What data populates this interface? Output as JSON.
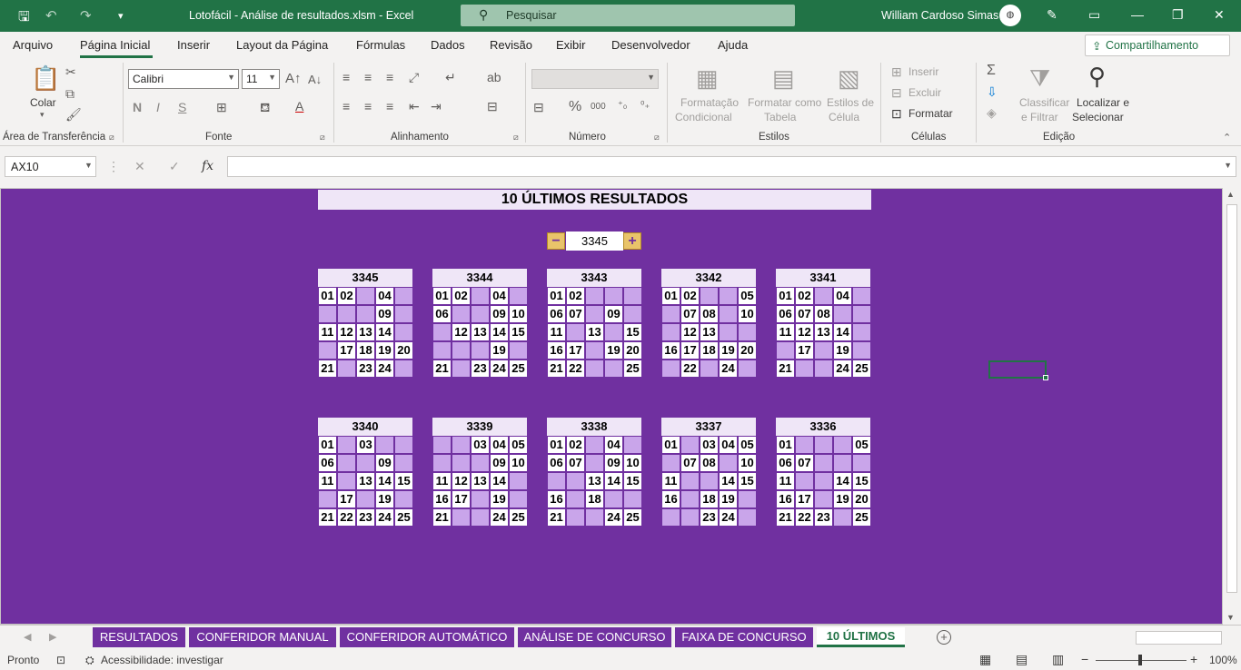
{
  "titlebar": {
    "title": "Lotofácil - Análise de resultados.xlsm  -  Excel",
    "search_placeholder": "Pesquisar",
    "user": "William Cardoso Simas"
  },
  "ribbon_tabs": [
    "Arquivo",
    "Página Inicial",
    "Inserir",
    "Layout da Página",
    "Fórmulas",
    "Dados",
    "Revisão",
    "Exibir",
    "Desenvolvedor",
    "Ajuda"
  ],
  "active_tab": "Página Inicial",
  "share_label": "Compartilhamento",
  "ribbon": {
    "clipboard": {
      "paste": "Colar",
      "group": "Área de Transferência"
    },
    "font": {
      "name": "Calibri",
      "size": "11",
      "group": "Fonte",
      "bold": "N",
      "italic": "I",
      "underline": "S"
    },
    "alignment": {
      "group": "Alinhamento"
    },
    "number": {
      "group": "Número",
      "format": "",
      "percent": "%",
      "thousands": "000"
    },
    "styles": {
      "group": "Estilos",
      "cond_format_1": "Formatação",
      "cond_format_2": "Condicional",
      "table_1": "Formatar como",
      "table_2": "Tabela",
      "cell_1": "Estilos de",
      "cell_2": "Célula"
    },
    "cells": {
      "group": "Células",
      "insert": "Inserir",
      "delete": "Excluir",
      "format": "Formatar"
    },
    "editing": {
      "group": "Edição",
      "sort_1": "Classificar",
      "sort_2": "e Filtrar",
      "find_1": "Localizar e",
      "find_2": "Selecionar"
    }
  },
  "formula_bar": {
    "name_box": "AX10",
    "fx": "fx",
    "formula": ""
  },
  "sheet": {
    "banner": "10 ÚLTIMOS RESULTADOS",
    "spinner_value": "3345",
    "spinner_minus": "−",
    "spinner_plus": "+",
    "cards": [
      {
        "id": "3345",
        "cells": [
          "01",
          "02",
          "",
          "04",
          "",
          "",
          "",
          "",
          "09",
          "",
          "11",
          "12",
          "13",
          "14",
          "",
          "",
          "17",
          "18",
          "19",
          "20",
          "21",
          "",
          "23",
          "24",
          ""
        ]
      },
      {
        "id": "3344",
        "cells": [
          "01",
          "02",
          "",
          "04",
          "",
          "06",
          "",
          "",
          "09",
          "10",
          "",
          "12",
          "13",
          "14",
          "15",
          "",
          "",
          "",
          "19",
          "",
          "21",
          "",
          "23",
          "24",
          "25"
        ]
      },
      {
        "id": "3343",
        "cells": [
          "01",
          "02",
          "",
          "",
          "",
          "06",
          "07",
          "",
          "09",
          "",
          "11",
          "",
          "13",
          "",
          "15",
          "16",
          "17",
          "",
          "19",
          "20",
          "21",
          "22",
          "",
          "",
          "25"
        ]
      },
      {
        "id": "3342",
        "cells": [
          "01",
          "02",
          "",
          "",
          "05",
          "",
          "07",
          "08",
          "",
          "10",
          "",
          "12",
          "13",
          "",
          "",
          "16",
          "17",
          "18",
          "19",
          "20",
          "",
          "22",
          "",
          "24",
          ""
        ]
      },
      {
        "id": "3341",
        "cells": [
          "01",
          "02",
          "",
          "04",
          "",
          "06",
          "07",
          "08",
          "",
          "",
          "11",
          "12",
          "13",
          "14",
          "",
          "",
          "17",
          "",
          "19",
          "",
          "21",
          "",
          "",
          "24",
          "25"
        ]
      },
      {
        "id": "3340",
        "cells": [
          "01",
          "",
          "03",
          "",
          "",
          "06",
          "",
          "",
          "09",
          "",
          "11",
          "",
          "13",
          "14",
          "15",
          "",
          "17",
          "",
          "19",
          "",
          "21",
          "22",
          "23",
          "24",
          "25"
        ]
      },
      {
        "id": "3339",
        "cells": [
          "",
          "",
          "03",
          "04",
          "05",
          "",
          "",
          "",
          "09",
          "10",
          "11",
          "12",
          "13",
          "14",
          "",
          "16",
          "17",
          "",
          "19",
          "",
          "21",
          "",
          "",
          "24",
          "25"
        ]
      },
      {
        "id": "3338",
        "cells": [
          "01",
          "02",
          "",
          "04",
          "",
          "06",
          "07",
          "",
          "09",
          "10",
          "",
          "",
          "13",
          "14",
          "15",
          "16",
          "",
          "18",
          "",
          "",
          "21",
          "",
          "",
          "24",
          "25"
        ]
      },
      {
        "id": "3337",
        "cells": [
          "01",
          "",
          "03",
          "04",
          "05",
          "",
          "07",
          "08",
          "",
          "10",
          "11",
          "",
          "",
          "14",
          "15",
          "16",
          "",
          "18",
          "19",
          "",
          "",
          "",
          "23",
          "24",
          ""
        ]
      },
      {
        "id": "3336",
        "cells": [
          "01",
          "",
          "",
          "",
          "05",
          "06",
          "07",
          "",
          "",
          "",
          "11",
          "",
          "",
          "14",
          "15",
          "16",
          "17",
          "",
          "19",
          "20",
          "21",
          "22",
          "23",
          "",
          "25"
        ]
      }
    ]
  },
  "sheet_tabs": [
    "RESULTADOS",
    "CONFERIDOR MANUAL",
    "CONFERIDOR AUTOMÁTICO",
    "ANÁLISE DE CONCURSO",
    "FAIXA DE CONCURSO",
    "10 ÚLTIMOS"
  ],
  "active_sheet": "10 ÚLTIMOS",
  "status": {
    "ready": "Pronto",
    "accessibility": "Acessibilidade: investigar",
    "zoom": "100%"
  },
  "colors": {
    "excel_green": "#217346",
    "sheet_bg": "#7030a0",
    "drawn_cell": "#ffffff",
    "empty_cell": "#c9a5ea"
  }
}
